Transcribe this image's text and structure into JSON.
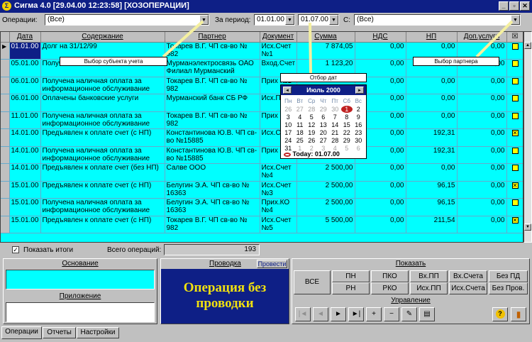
{
  "window": {
    "title": "Сигма 4.0 [29.04.00 12:23:58] [ХОЗОПЕРАЦИИ]",
    "app_icon_glyph": "Σ",
    "minimize_glyph": "_",
    "maximize_glyph": "▫",
    "close_glyph": "✕"
  },
  "filters": {
    "operations_label": "Операции:",
    "operations_value": "(Все)",
    "period_label": "За период:",
    "date_from": "01.01.00",
    "date_to": "01.07.00",
    "with_label": "С:",
    "partner_value": "(Все)"
  },
  "callouts": {
    "subject": "Выбор субъекта учета",
    "dates": "Отбор дат",
    "partner": "Выбор партнера"
  },
  "table": {
    "columns": [
      "Дата",
      "Содержание",
      "Партнер",
      "Документ",
      "Сумма",
      "НДС",
      "НП",
      "Доп.услуги",
      "☒"
    ],
    "rows": [
      {
        "date": "01.01.00",
        "content": "Долг на 31/12/99",
        "partner": "Токарев В.Г. ЧП св-во № 982",
        "doc": "Исх.Счет №1",
        "sum": "7 874,05",
        "nds": "0,00",
        "np": "0,00",
        "extra": "0,00",
        "checked": false
      },
      {
        "date": "05.01.00",
        "content": "Получены с...",
        "partner": "Мурманэлектросвязь ОАО Филиал Мурманский",
        "doc": "Вход.Счет",
        "sum": "1 123,20",
        "nds": "0,00",
        "np": "0,00",
        "extra": "0,00",
        "checked": false
      },
      {
        "date": "06.01.00",
        "content": "Получена наличная оплата за информационное обслуживание",
        "partner": "Токарев В.Г. ЧП св-во № 982",
        "doc": "Прих №1",
        "sum": "",
        "nds": "0,00",
        "np": "0,00",
        "extra": "0,00",
        "checked": false
      },
      {
        "date": "06.01.00",
        "content": "Оплачены банковские услуги",
        "partner": "Мурманский банк СБ РФ",
        "doc": "Исх.П",
        "sum": "",
        "nds": "0,00",
        "np": "0,00",
        "extra": "0,00",
        "checked": false
      },
      {
        "date": "11.01.00",
        "content": "Получена наличная оплата за информационное обслуживание",
        "partner": "Токарев В.Г. ЧП св-во № 982",
        "doc": "Прих №2",
        "sum": "",
        "nds": "0,00",
        "np": "0,00",
        "extra": "0,00",
        "checked": false
      },
      {
        "date": "14.01.00",
        "content": "Предъявлен к оплате счет (с НП)",
        "partner": "Константинова Ю.В. ЧП св-во №15885",
        "doc": "Исх.С №2",
        "sum": "",
        "nds": "0,00",
        "np": "192,31",
        "extra": "0,00",
        "checked": true
      },
      {
        "date": "14.01.00",
        "content": "Получена наличная оплата за информационное обслуживание",
        "partner": "Константинова Ю.В. ЧП св-во №15885",
        "doc": "Прих №3",
        "sum": "",
        "nds": "0,00",
        "np": "192,31",
        "extra": "0,00",
        "checked": false
      },
      {
        "date": "14.01.00",
        "content": "Предъявлен к оплате счет (без НП)",
        "partner": "Салве ООО",
        "doc": "Исх.Счет №4",
        "sum": "2 500,00",
        "nds": "0,00",
        "np": "0,00",
        "extra": "0,00",
        "checked": false
      },
      {
        "date": "15.01.00",
        "content": "Предъявлен к оплате счет (с НП)",
        "partner": "Белугин Э.А. ЧП св-во № 16363",
        "doc": "Исх.Счет №3",
        "sum": "2 500,00",
        "nds": "0,00",
        "np": "96,15",
        "extra": "0,00",
        "checked": true
      },
      {
        "date": "15.01.00",
        "content": "Получена наличная оплата за информационное обслуживание",
        "partner": "Белугин Э.А. ЧП св-во № 16363",
        "doc": "Прих.КО №4",
        "sum": "2 500,00",
        "nds": "0,00",
        "np": "96,15",
        "extra": "0,00",
        "checked": false
      },
      {
        "date": "15.01.00",
        "content": "Предъявлен к оплате счет (с НП)",
        "partner": "Токарев В.Г. ЧП св-во № 982",
        "doc": "Исх.Счет №5",
        "sum": "5 500,00",
        "nds": "0,00",
        "np": "211,54",
        "extra": "0,00",
        "checked": true
      }
    ]
  },
  "calendar": {
    "month": "Июль 2000",
    "prev_glyph": "◄",
    "next_glyph": "►",
    "day_names": [
      "Пн",
      "Вт",
      "Ср",
      "Чт",
      "Пт",
      "Сб",
      "Вс"
    ],
    "weeks": [
      [
        "26",
        "27",
        "28",
        "29",
        "30",
        "1",
        "2"
      ],
      [
        "3",
        "4",
        "5",
        "6",
        "7",
        "8",
        "9"
      ],
      [
        "10",
        "11",
        "12",
        "13",
        "14",
        "15",
        "16"
      ],
      [
        "17",
        "18",
        "19",
        "20",
        "21",
        "22",
        "23"
      ],
      [
        "24",
        "25",
        "26",
        "27",
        "28",
        "29",
        "30"
      ],
      [
        "31",
        "1",
        "2",
        "3",
        "4",
        "5",
        "6"
      ]
    ],
    "today": "Today: 01.07.00"
  },
  "totals": {
    "show_totals_label": "Показать итоги",
    "total_ops_label": "Всего операций:",
    "total_ops_value": "193"
  },
  "panels": {
    "basis_label": "Основание",
    "attachment_label": "Приложение",
    "posting_label": "Проводка",
    "post_button": "Провести",
    "posting_text": "Операция без проводки",
    "show_label": "Показать",
    "manage_label": "Управление"
  },
  "show_buttons": {
    "all": "ВСЕ",
    "row1": [
      "ПН",
      "ПКО",
      "Вх.ПП",
      "Вх.Счета",
      "Без ПД"
    ],
    "row2": [
      "РН",
      "РКО",
      "Исх.ПП",
      "Исх.Счета",
      "Без Пров."
    ]
  },
  "nav_buttons": [
    "|◄",
    "◄",
    "►",
    "►|",
    "+",
    "−",
    "✎",
    "▤"
  ],
  "help_glyph": "?",
  "exit_glyph": "▮",
  "tabs": [
    "Операции",
    "Отчеты",
    "Настройки"
  ]
}
